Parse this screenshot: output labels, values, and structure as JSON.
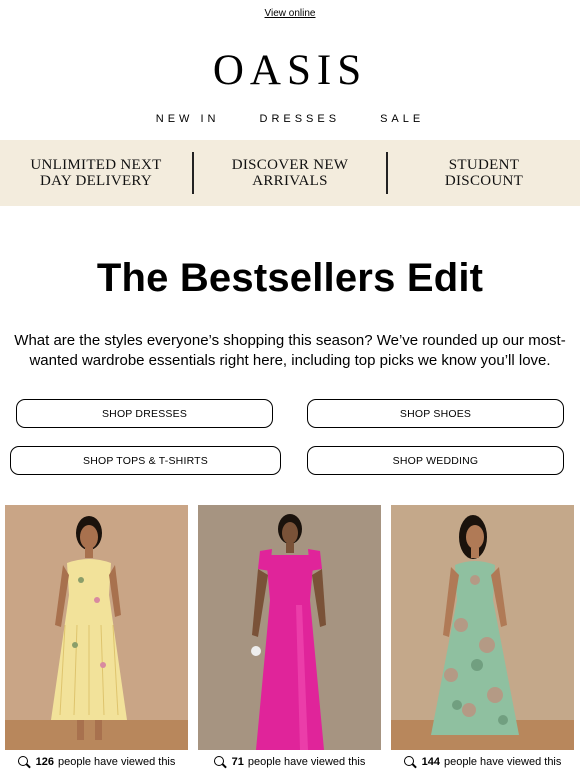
{
  "header": {
    "view_online": "View online",
    "logo": "OASIS",
    "nav": [
      "NEW IN",
      "DRESSES",
      "SALE"
    ]
  },
  "promo": {
    "items": [
      {
        "line1": "UNLIMITED NEXT",
        "line2": "DAY DELIVERY"
      },
      {
        "line1": "DISCOVER NEW",
        "line2": "ARRIVALS"
      },
      {
        "line1": "STUDENT",
        "line2": "DISCOUNT"
      }
    ]
  },
  "main": {
    "headline": "The Bestsellers Edit",
    "intro": "What are the styles everyone’s shopping this season? We’ve rounded up our most-wanted wardrobe essentials right here, including top picks we know you’ll love.",
    "buttons": {
      "dresses": "SHOP DRESSES",
      "shoes": "SHOP SHOES",
      "tops": "SHOP TOPS & T-SHIRTS",
      "wedding": "SHOP WEDDING"
    }
  },
  "products": [
    {
      "views": "126",
      "views_suffix": "people have viewed this",
      "dress_color": "#f2e29a"
    },
    {
      "views": "71",
      "views_suffix": "people have viewed this",
      "dress_color": "#e0249a"
    },
    {
      "views": "144",
      "views_suffix": "people have viewed this",
      "dress_color": "#8fc0a0"
    }
  ]
}
